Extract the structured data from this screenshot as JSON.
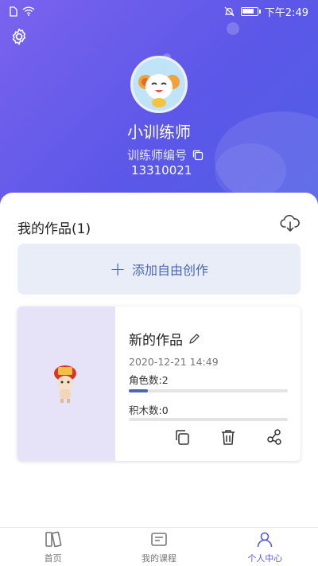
{
  "status_bar": {
    "time": "下午2:49"
  },
  "profile": {
    "name": "小训练师",
    "id_label": "训练师编号",
    "id_value": "13310021"
  },
  "works": {
    "title": "我的作品(1)",
    "add_label": "添加自由创作",
    "items": [
      {
        "name": "新的作品",
        "date": "2020-12-21 14:49",
        "roles_label": "角色数:2",
        "roles_progress": 0.12,
        "blocks_label": "积木数:0",
        "blocks_progress": 0
      }
    ]
  },
  "tabs": [
    {
      "label": "首页",
      "icon": "book-icon",
      "active": false
    },
    {
      "label": "我的课程",
      "icon": "course-icon",
      "active": false
    },
    {
      "label": "个人中心",
      "icon": "profile-icon",
      "active": true
    }
  ],
  "colors": {
    "accent": "#4a68b5",
    "header": "#6a5eec"
  }
}
